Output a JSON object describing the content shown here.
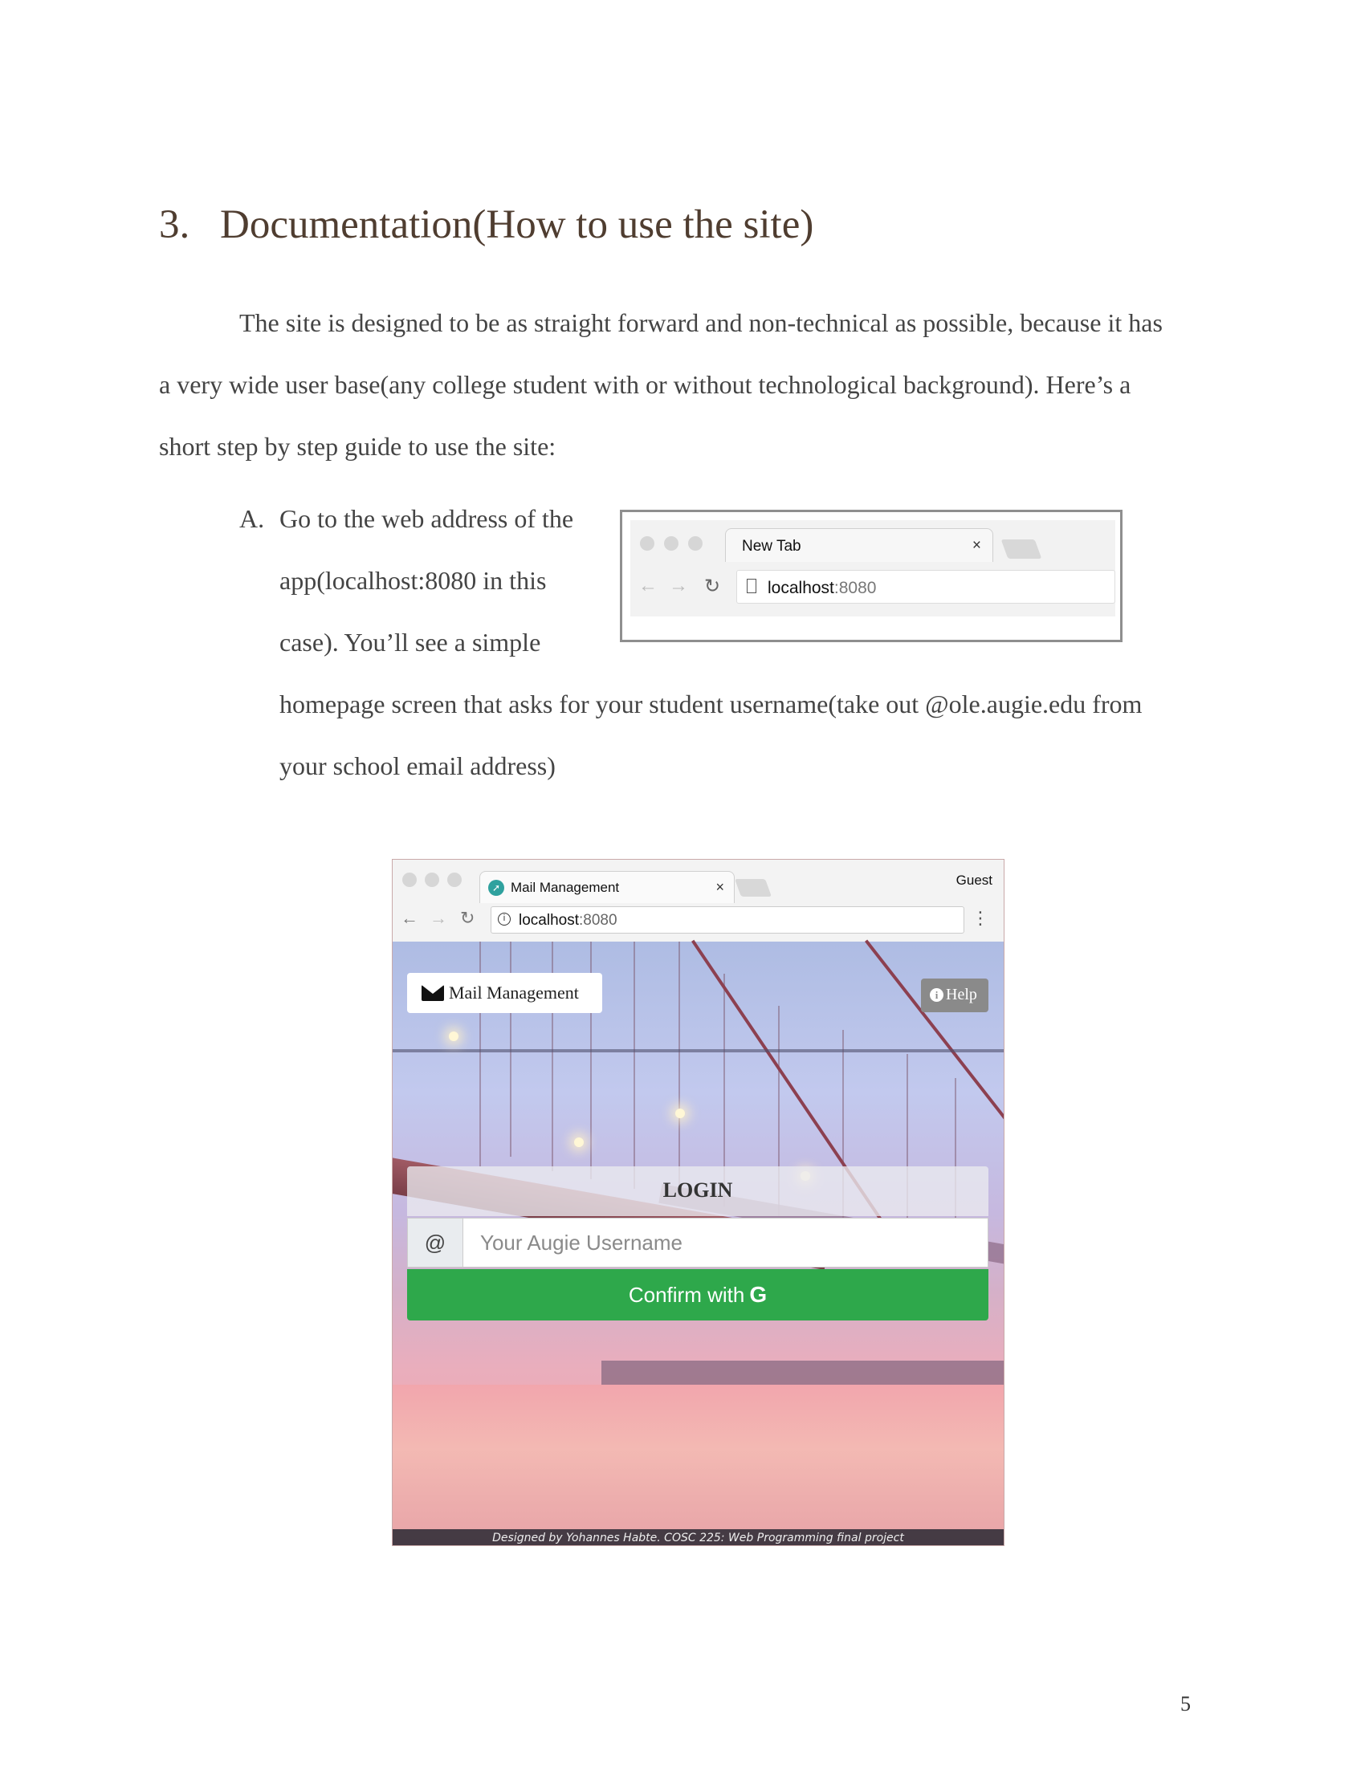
{
  "heading": {
    "number": "3.",
    "title": "Documentation(How to use the site)"
  },
  "intro": {
    "line1": "The site is designed to be as straight forward and non-technical as possible, because it has",
    "line2": "a very wide user base(any college student with or without technological background). Here’s a",
    "line3": "short step by step guide to use the site:"
  },
  "step_a": {
    "marker": "A.",
    "line1": "Go to the web address of the",
    "line2": "app(localhost:8080 in this",
    "line3": "case). You’ll see a simple",
    "line4": "homepage screen that asks for your student username(take out @ole.augie.edu from",
    "line5": "your school email address)"
  },
  "browser_small": {
    "tab_title": "New Tab",
    "tab_close": "×",
    "url_host": "localhost",
    "url_port": ":8080"
  },
  "app_screenshot": {
    "tab_title": "Mail Management",
    "tab_close": "×",
    "profile": "Guest",
    "url_host": "localhost",
    "url_port": ":8080",
    "menu_glyph": "⋮",
    "brand_label": "Mail Management",
    "help_label": "Help",
    "login_title": "LOGIN",
    "at_symbol": "@",
    "username_placeholder": "Your Augie Username",
    "confirm_label": "Confirm with",
    "confirm_g": "G",
    "footer_text": "Designed by Yohannes Habte. COSC 225: Web Programming final project"
  },
  "page_number": "5"
}
